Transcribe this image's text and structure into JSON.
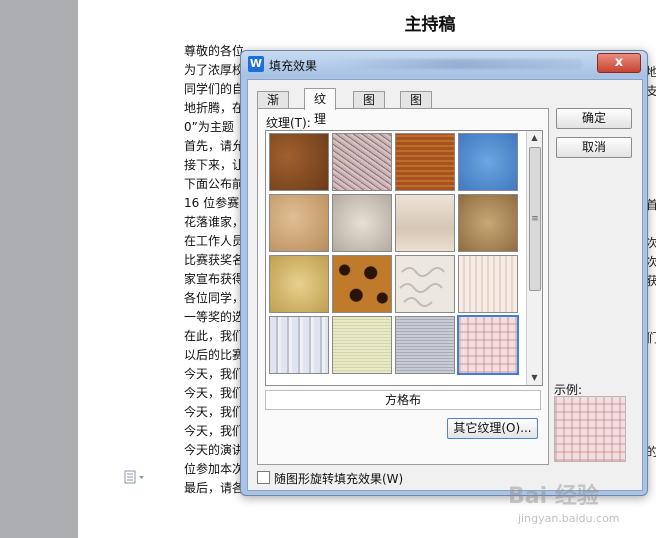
{
  "document": {
    "title": "主持稿",
    "lines": [
      "尊敬的各位",
      "为了浓厚校",
      "同学们的自",
      "地折腾，在",
      "0”为主题",
      "首先，请允",
      "接下来，让",
      "下面公布前",
      "16 位参赛",
      "花落谁家，",
      "在工作人员",
      "比赛获奖名",
      "家宣布获得",
      "各位同学，",
      "一等奖的选",
      "在此，我们",
      "以后的比赛",
      "今天，我们",
      "今天，我们",
      "今天，我们",
      "今天，我们",
      "今天的演讲",
      "位参加本次",
      "最后，请各"
    ],
    "right_chars": [
      "地",
      "支",
      "首",
      "次",
      "次",
      "获",
      "们",
      "的"
    ]
  },
  "dialog": {
    "title": "填充效果",
    "app_icon_letter": "W",
    "close_symbol": "x",
    "tabs": [
      "渐变",
      "纹理",
      "图案",
      "图片"
    ],
    "active_tab": "纹理",
    "texture_label": "纹理(T):",
    "selected_texture_name": "方格布",
    "more_button": "其它纹理(O)...",
    "ok_button": "确定",
    "cancel_button": "取消",
    "sample_label": "示例:",
    "rotate_checkbox_label": "随图形旋转填充效果(W)",
    "rotate_checked": false
  },
  "texture_icons": [
    "brown-leather-texture-icon",
    "pink-fabric-texture-icon",
    "woven-mat-texture-icon",
    "blue-denim-texture-icon",
    "tan-paper-texture-icon",
    "gray-granite-texture-icon",
    "beige-marble-texture-icon",
    "brown-cork-texture-icon",
    "yellow-sand-texture-icon",
    "leopard-print-texture-icon",
    "handwriting-paper-texture-icon",
    "pink-stripe-texture-icon",
    "blue-stripe-fabric-texture-icon",
    "green-canvas-texture-icon",
    "gray-weave-texture-icon",
    "pink-plaid-texture-icon"
  ],
  "watermark": {
    "main": "Bai 经验",
    "sub": "jingyan.baidu.com"
  }
}
